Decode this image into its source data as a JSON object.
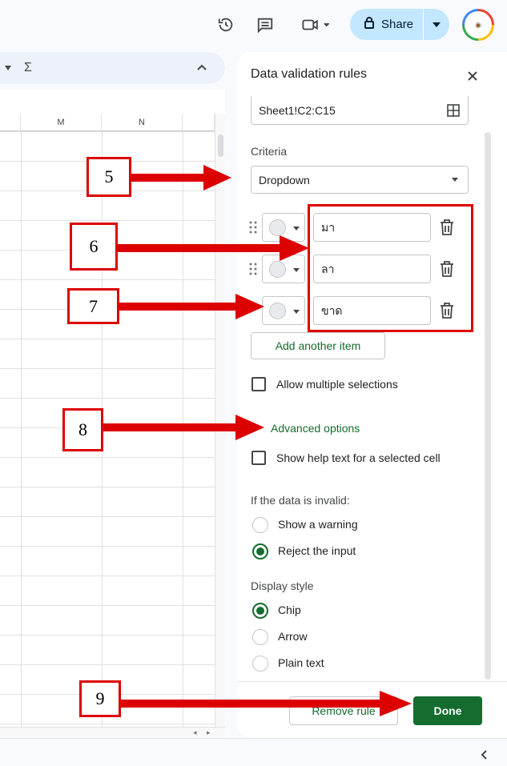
{
  "toolbar": {
    "share_label": "Share",
    "icons": [
      "history-icon",
      "comment-icon",
      "video-icon",
      "lock-icon",
      "chevron-down-icon"
    ]
  },
  "formula_bar": {
    "sigma": "Σ"
  },
  "grid": {
    "columns": [
      "M",
      "N"
    ]
  },
  "panel": {
    "title": "Data validation rules",
    "range": "Sheet1!C2:C15",
    "criteria_label": "Criteria",
    "criteria_value": "Dropdown",
    "items": [
      "มา",
      "ลา",
      "ขาด"
    ],
    "add_item": "Add another item",
    "allow_multiple": "Allow multiple selections",
    "advanced": "Advanced options",
    "help_text": "Show help text for a selected cell",
    "invalid_label": "If the data is invalid:",
    "invalid_options": [
      "Show a warning",
      "Reject the input"
    ],
    "invalid_selected": "Reject the input",
    "display_label": "Display style",
    "display_options": [
      "Chip",
      "Arrow",
      "Plain text"
    ],
    "display_selected": "Chip",
    "remove_rule": "Remove rule",
    "done": "Done"
  },
  "annotations": [
    "5",
    "6",
    "7",
    "8",
    "9"
  ],
  "colors": {
    "accent": "#146c2e",
    "annotation_red": "#dd0000",
    "share_bg": "#c2e7ff"
  }
}
